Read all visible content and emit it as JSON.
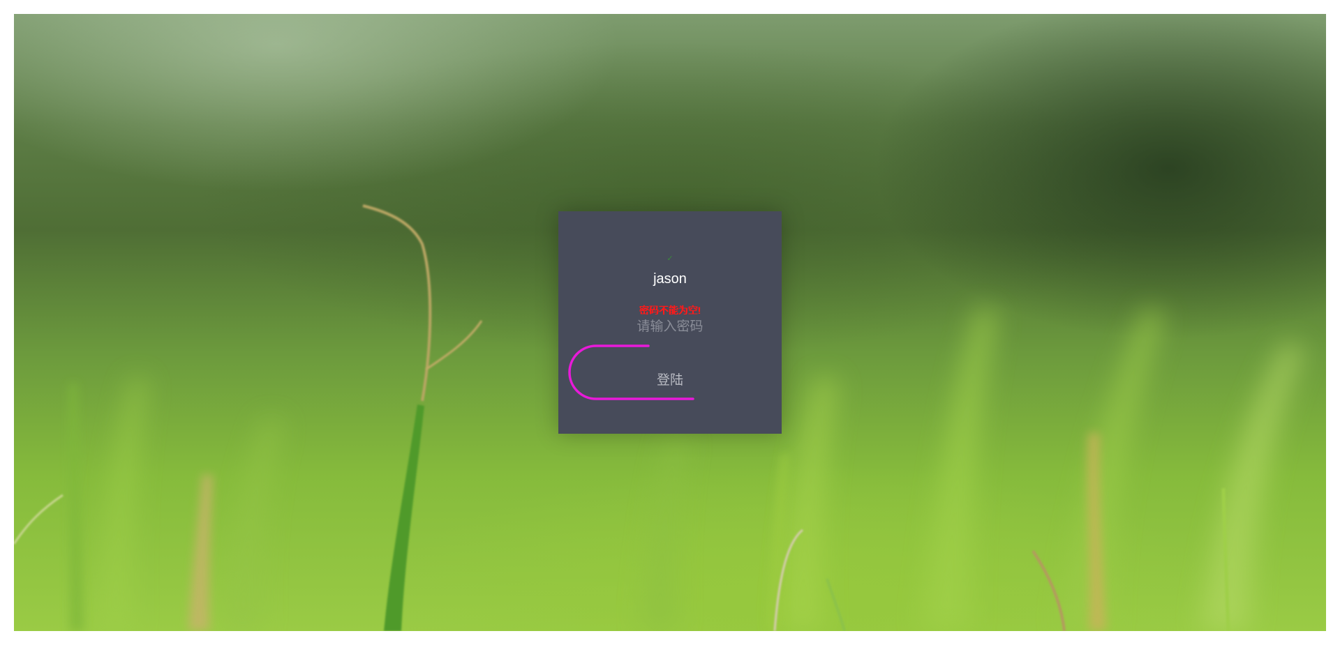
{
  "login": {
    "check_mark": "✓",
    "username_value": "jason",
    "password_error": "密码不能为空!",
    "password_placeholder": "请输入密码",
    "submit_label": "登陆"
  },
  "colors": {
    "card_background": "#474b5a",
    "error_text": "#ff1a1a",
    "button_outline": "#e81ad9",
    "valid_indicator": "#3a8a3a"
  },
  "icons": {
    "valid_indicator": "check-icon"
  }
}
